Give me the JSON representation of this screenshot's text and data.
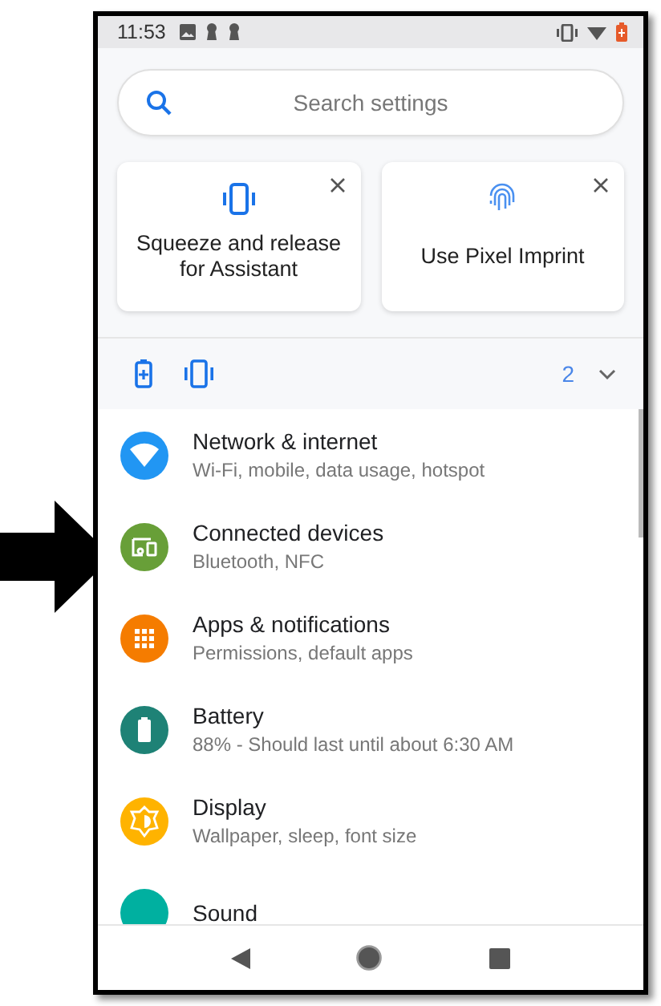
{
  "status_bar": {
    "time": "11:53"
  },
  "search": {
    "placeholder": "Search settings"
  },
  "suggestions": [
    {
      "kind": "squeeze",
      "title": "Squeeze and release for Assistant"
    },
    {
      "kind": "fingerprint",
      "title": "Use Pixel Imprint"
    }
  ],
  "conditions": {
    "items": [
      {
        "kind": "battery-saver"
      },
      {
        "kind": "vibrate"
      }
    ],
    "count": "2",
    "expanded": false
  },
  "settings": [
    {
      "kind": "wifi",
      "title": "Network & internet",
      "subtitle": "Wi-Fi, mobile, data usage, hotspot",
      "color": "#2196f3"
    },
    {
      "kind": "devices",
      "title": "Connected devices",
      "subtitle": "Bluetooth, NFC",
      "color": "#689f38"
    },
    {
      "kind": "apps",
      "title": "Apps & notifications",
      "subtitle": "Permissions, default apps",
      "color": "#f57c00"
    },
    {
      "kind": "battery",
      "title": "Battery",
      "subtitle": "88% - Should last until about 6:30 AM",
      "color": "#1e8276"
    },
    {
      "kind": "display",
      "title": "Display",
      "subtitle": "Wallpaper, sleep, font size",
      "color": "#ffb300"
    },
    {
      "kind": "sound",
      "title": "Sound",
      "color": "#00b0a0"
    }
  ]
}
